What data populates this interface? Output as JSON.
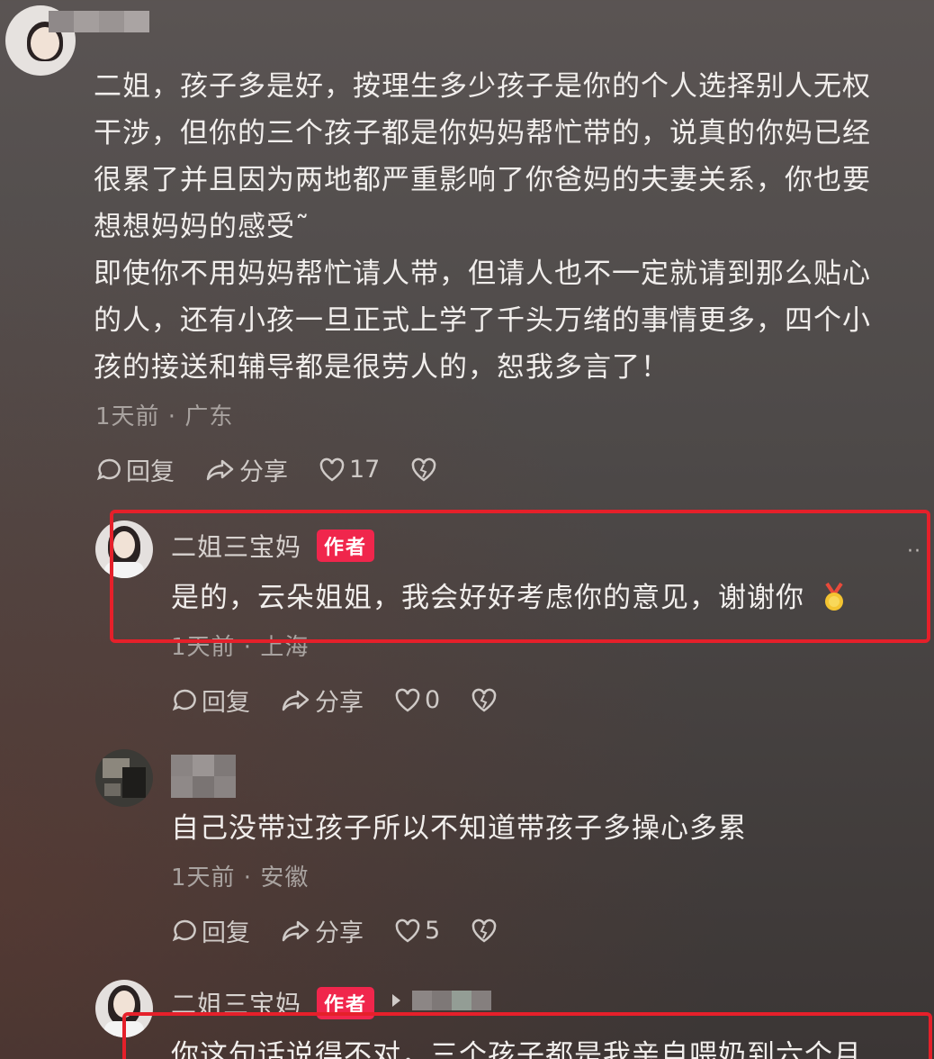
{
  "comments": [
    {
      "text_lines": [
        "二姐，孩子多是好，按理生多少孩子是你的个人选择别人无权",
        "干涉，但你的三个孩子都是你妈妈帮忙带的，说真的你妈已经",
        "很累了并且因为两地都严重影响了你爸妈的夫妻关系，你也要",
        "想想妈妈的感受˜",
        "即使你不用妈妈帮忙请人带，但请人也不一定就请到那么贴心",
        "的人，还有小孩一旦正式上学了千头万绪的事情更多，四个小",
        "孩的接送和辅导都是很劳人的，恕我多言了！"
      ],
      "meta": "1天前 · 广东",
      "reply_label": "回复",
      "share_label": "分享",
      "likes": "17"
    },
    {
      "author": "二姐三宝妈",
      "badge": "作者",
      "text": "是的，云朵姐姐，我会好好考虑你的意见，谢谢你",
      "meta": "1天前 · 上海",
      "reply_label": "回复",
      "share_label": "分享",
      "likes": "0"
    },
    {
      "text": "自己没带过孩子所以不知道带孩子多操心多累",
      "meta": "1天前 · 安徽",
      "reply_label": "回复",
      "share_label": "分享",
      "likes": "5"
    },
    {
      "author": "二姐三宝妈",
      "badge": "作者",
      "text": "你这句话说得不对，三个孩子都是我亲自喂奶到六个月"
    }
  ],
  "more_icon": "more-dots-icon",
  "colors": {
    "highlight": "#e5202a",
    "badge": "#f0264c"
  }
}
